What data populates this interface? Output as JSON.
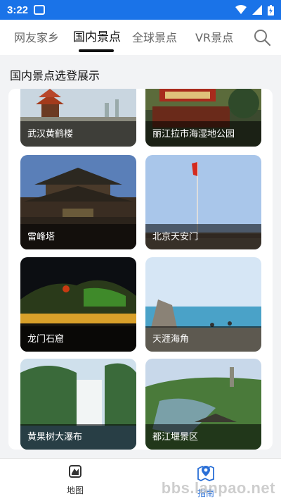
{
  "status_bar": {
    "time": "3:22"
  },
  "tabs": [
    {
      "label": "网友家乡"
    },
    {
      "label": "国内景点"
    },
    {
      "label": "全球景点"
    },
    {
      "label": "VR景点"
    }
  ],
  "section_title": "国内景点选登展示",
  "spots": [
    {
      "name": "武汉黄鹤楼"
    },
    {
      "name": "丽江拉市海湿地公园"
    },
    {
      "name": "雷峰塔"
    },
    {
      "name": "北京天安门"
    },
    {
      "name": "龙门石窟"
    },
    {
      "name": "天涯海角"
    },
    {
      "name": "黄果树大瀑布"
    },
    {
      "name": "都江堰景区"
    }
  ],
  "bottom_nav": [
    {
      "label": "地图"
    },
    {
      "label": "指南"
    }
  ],
  "watermark": "bbs.lanpao.net",
  "colors": {
    "accent": "#1a73e8",
    "nav_active": "#2a6fd6"
  }
}
